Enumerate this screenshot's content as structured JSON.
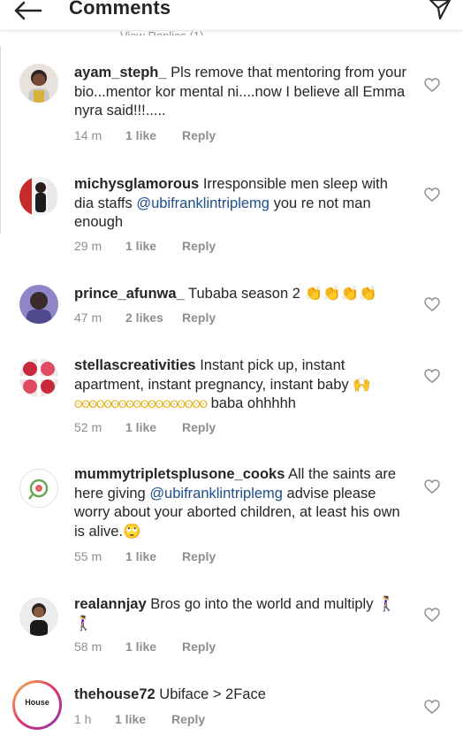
{
  "header": {
    "title": "Comments",
    "back_icon": "arrow-left-icon",
    "send_icon": "paper-plane-icon"
  },
  "view_replies_partial": "View Replies (1)",
  "colors": {
    "text": "#262626",
    "secondary": "#8e8e8e",
    "mention": "#1d4e89"
  },
  "comments": [
    {
      "username": "ayam_steph_",
      "text": "Pls remove that mentoring from your bio...mentor kor mental ni....now I believe all Emma nyra said!!!.....",
      "time": "14 m",
      "likes": "1 like",
      "reply": "Reply"
    },
    {
      "username": "michysglamorous",
      "text_before": "Irresponsible men sleep with dia staffs ",
      "mention": "@ubifranklintriplemg",
      "text_after": "  you re not man enough",
      "time": "29 m",
      "likes": "1 like",
      "reply": "Reply"
    },
    {
      "username": "prince_afunwa_",
      "text": "Tubaba season 2 👏👏👏👏",
      "time": "47 m",
      "likes": "2 likes",
      "reply": "Reply"
    },
    {
      "username": "stellascreativities",
      "text_before": "Instant pick up, instant apartment, instant pregnancy, instant baby 🙌",
      "text_dots": "ʘʘʘʘʘʘʘʘʘʘʘʘʘʘʘʘʘʘ",
      "text_after": " baba ohhhhh",
      "time": "52 m",
      "likes": "1 like",
      "reply": "Reply"
    },
    {
      "username": "mummytripletsplusone_cooks",
      "text_before": "All the saints are here giving ",
      "mention": "@ubifranklintriplemg",
      "text_after": " advise please worry about your aborted children, at least his own is alive.🙄",
      "time": "55 m",
      "likes": "1 like",
      "reply": "Reply"
    },
    {
      "username": "realannjay",
      "text": "Bros go into the world and multiply 🚶‍♀️🚶‍♀️",
      "time": "58 m",
      "likes": "1 like",
      "reply": "Reply"
    },
    {
      "username": "thehouse72",
      "text": "Ubiface > 2Face",
      "time": "1 h",
      "likes": "1 like",
      "reply": "Reply",
      "avatar_label": "House"
    }
  ]
}
